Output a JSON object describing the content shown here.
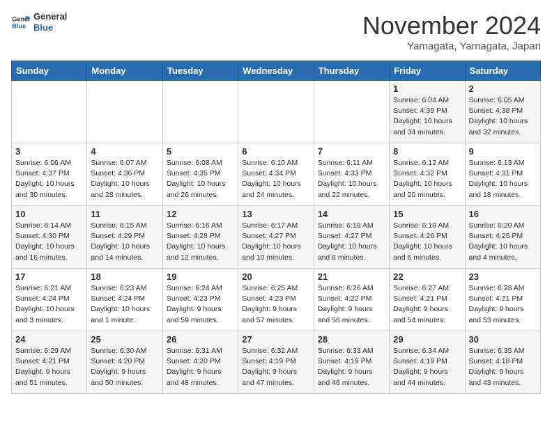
{
  "logo": {
    "general": "General",
    "blue": "Blue"
  },
  "header": {
    "title": "November 2024",
    "location": "Yamagata, Yamagata, Japan"
  },
  "days_of_week": [
    "Sunday",
    "Monday",
    "Tuesday",
    "Wednesday",
    "Thursday",
    "Friday",
    "Saturday"
  ],
  "weeks": [
    [
      {
        "day": "",
        "info": ""
      },
      {
        "day": "",
        "info": ""
      },
      {
        "day": "",
        "info": ""
      },
      {
        "day": "",
        "info": ""
      },
      {
        "day": "",
        "info": ""
      },
      {
        "day": "1",
        "info": "Sunrise: 6:04 AM\nSunset: 4:39 PM\nDaylight: 10 hours\nand 34 minutes."
      },
      {
        "day": "2",
        "info": "Sunrise: 6:05 AM\nSunset: 4:38 PM\nDaylight: 10 hours\nand 32 minutes."
      }
    ],
    [
      {
        "day": "3",
        "info": "Sunrise: 6:06 AM\nSunset: 4:37 PM\nDaylight: 10 hours\nand 30 minutes."
      },
      {
        "day": "4",
        "info": "Sunrise: 6:07 AM\nSunset: 4:36 PM\nDaylight: 10 hours\nand 28 minutes."
      },
      {
        "day": "5",
        "info": "Sunrise: 6:08 AM\nSunset: 4:35 PM\nDaylight: 10 hours\nand 26 minutes."
      },
      {
        "day": "6",
        "info": "Sunrise: 6:10 AM\nSunset: 4:34 PM\nDaylight: 10 hours\nand 24 minutes."
      },
      {
        "day": "7",
        "info": "Sunrise: 6:11 AM\nSunset: 4:33 PM\nDaylight: 10 hours\nand 22 minutes."
      },
      {
        "day": "8",
        "info": "Sunrise: 6:12 AM\nSunset: 4:32 PM\nDaylight: 10 hours\nand 20 minutes."
      },
      {
        "day": "9",
        "info": "Sunrise: 6:13 AM\nSunset: 4:31 PM\nDaylight: 10 hours\nand 18 minutes."
      }
    ],
    [
      {
        "day": "10",
        "info": "Sunrise: 6:14 AM\nSunset: 4:30 PM\nDaylight: 10 hours\nand 16 minutes."
      },
      {
        "day": "11",
        "info": "Sunrise: 6:15 AM\nSunset: 4:29 PM\nDaylight: 10 hours\nand 14 minutes."
      },
      {
        "day": "12",
        "info": "Sunrise: 6:16 AM\nSunset: 4:28 PM\nDaylight: 10 hours\nand 12 minutes."
      },
      {
        "day": "13",
        "info": "Sunrise: 6:17 AM\nSunset: 4:27 PM\nDaylight: 10 hours\nand 10 minutes."
      },
      {
        "day": "14",
        "info": "Sunrise: 6:18 AM\nSunset: 4:27 PM\nDaylight: 10 hours\nand 8 minutes."
      },
      {
        "day": "15",
        "info": "Sunrise: 6:19 AM\nSunset: 4:26 PM\nDaylight: 10 hours\nand 6 minutes."
      },
      {
        "day": "16",
        "info": "Sunrise: 6:20 AM\nSunset: 4:25 PM\nDaylight: 10 hours\nand 4 minutes."
      }
    ],
    [
      {
        "day": "17",
        "info": "Sunrise: 6:21 AM\nSunset: 4:24 PM\nDaylight: 10 hours\nand 3 minutes."
      },
      {
        "day": "18",
        "info": "Sunrise: 6:23 AM\nSunset: 4:24 PM\nDaylight: 10 hours\nand 1 minute."
      },
      {
        "day": "19",
        "info": "Sunrise: 6:24 AM\nSunset: 4:23 PM\nDaylight: 9 hours\nand 59 minutes."
      },
      {
        "day": "20",
        "info": "Sunrise: 6:25 AM\nSunset: 4:23 PM\nDaylight: 9 hours\nand 57 minutes."
      },
      {
        "day": "21",
        "info": "Sunrise: 6:26 AM\nSunset: 4:22 PM\nDaylight: 9 hours\nand 56 minutes."
      },
      {
        "day": "22",
        "info": "Sunrise: 6:27 AM\nSunset: 4:21 PM\nDaylight: 9 hours\nand 54 minutes."
      },
      {
        "day": "23",
        "info": "Sunrise: 6:28 AM\nSunset: 4:21 PM\nDaylight: 9 hours\nand 53 minutes."
      }
    ],
    [
      {
        "day": "24",
        "info": "Sunrise: 6:29 AM\nSunset: 4:21 PM\nDaylight: 9 hours\nand 51 minutes."
      },
      {
        "day": "25",
        "info": "Sunrise: 6:30 AM\nSunset: 4:20 PM\nDaylight: 9 hours\nand 50 minutes."
      },
      {
        "day": "26",
        "info": "Sunrise: 6:31 AM\nSunset: 4:20 PM\nDaylight: 9 hours\nand 48 minutes."
      },
      {
        "day": "27",
        "info": "Sunrise: 6:32 AM\nSunset: 4:19 PM\nDaylight: 9 hours\nand 47 minutes."
      },
      {
        "day": "28",
        "info": "Sunrise: 6:33 AM\nSunset: 4:19 PM\nDaylight: 9 hours\nand 46 minutes."
      },
      {
        "day": "29",
        "info": "Sunrise: 6:34 AM\nSunset: 4:19 PM\nDaylight: 9 hours\nand 44 minutes."
      },
      {
        "day": "30",
        "info": "Sunrise: 6:35 AM\nSunset: 4:18 PM\nDaylight: 9 hours\nand 43 minutes."
      }
    ]
  ]
}
